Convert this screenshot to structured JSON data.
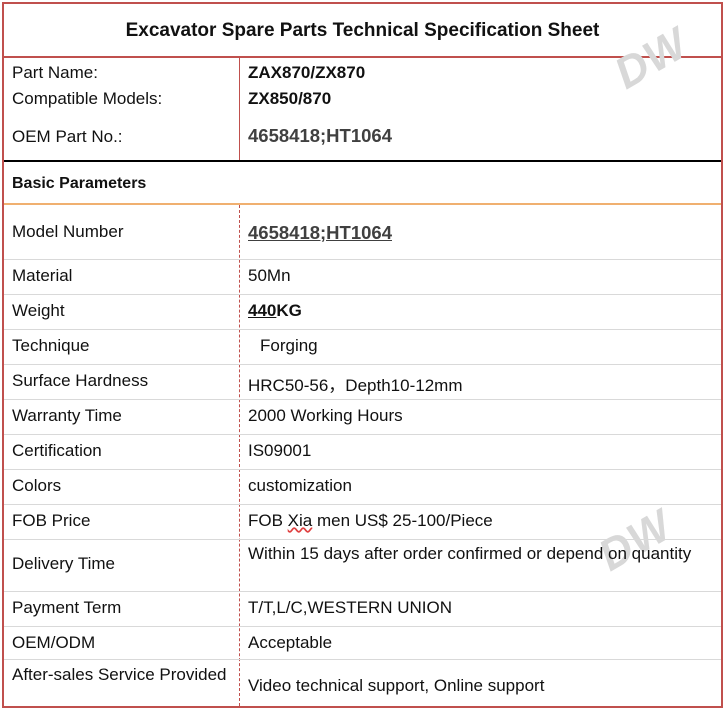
{
  "title": "Excavator Spare Parts Technical Specification Sheet",
  "header_rows": [
    {
      "label": "Part Name:",
      "value": "ZAX870/ZX870"
    },
    {
      "label": "Compatible Models:",
      "value": "ZX850/870"
    },
    {
      "label": "OEM Part No.:",
      "value": "4658418;HT1064"
    }
  ],
  "section_title": "Basic Parameters",
  "params": {
    "model_number": {
      "label": "Model Number",
      "value": "4658418;HT1064"
    },
    "material": {
      "label": "Material",
      "value": "50Mn"
    },
    "weight": {
      "label": "Weight",
      "value_number": "440",
      "value_unit": "KG"
    },
    "technique": {
      "label": "Technique",
      "value": "Forging"
    },
    "surface_hardness": {
      "label": "Surface Hardness",
      "value": "HRC50-56，Depth10-12mm"
    },
    "warranty": {
      "label": "Warranty Time",
      "value": "2000 Working Hours"
    },
    "certification": {
      "label": "Certification",
      "value": "IS09001"
    },
    "colors": {
      "label": "Colors",
      "value": "customization"
    },
    "fob_price": {
      "label": "FOB Price",
      "value_prefix": "FOB ",
      "value_marked": "Xia",
      "value_suffix": " men US$ 25-100/Piece"
    },
    "delivery": {
      "label": "Delivery Time",
      "value": "Within 15 days after order confirmed or depend on quantity"
    },
    "payment": {
      "label": "Payment Term",
      "value": "T/T,L/C,WESTERN UNION"
    },
    "oem_odm": {
      "label": "OEM/ODM",
      "value": "Acceptable"
    },
    "after_sales": {
      "label": "After-sales Service Provided",
      "value": "Video technical support, Online support"
    }
  },
  "watermark": "DW"
}
